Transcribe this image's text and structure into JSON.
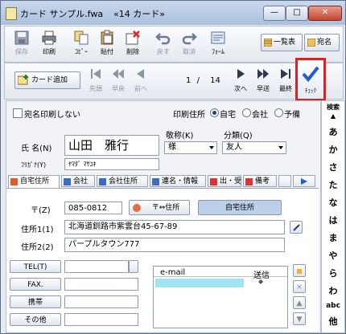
{
  "window": {
    "title": "カード サンプル.fwa",
    "card_label": "«14 カード»",
    "minimize": "—",
    "maximize": "□",
    "close": "✕"
  },
  "toolbar": {
    "tools": [
      {
        "label": "保存",
        "icon": "save-icon",
        "enabled": false
      },
      {
        "label": "印刷",
        "icon": "printer-icon",
        "enabled": true
      },
      {
        "label": "ｺﾋﾟｰ",
        "icon": "copy-icon",
        "enabled": true
      },
      {
        "label": "貼付",
        "icon": "paste-icon",
        "enabled": true
      },
      {
        "label": "削除",
        "icon": "delete-icon",
        "enabled": true
      },
      {
        "label": "戻す",
        "icon": "undo-icon",
        "enabled": false
      },
      {
        "label": "取消",
        "icon": "redo-icon",
        "enabled": false
      },
      {
        "label": "ﾌｫｰﾑ",
        "icon": "form-icon",
        "enabled": true
      }
    ],
    "list_button": "一覧表",
    "name_button": "宛名"
  },
  "navbar": {
    "add_card": "カード追加",
    "first": "先頭",
    "fast_back": "早戻",
    "prev": "前へ",
    "current": "1",
    "separator": "/",
    "total": "14",
    "next": "次へ",
    "fast_forward": "早送",
    "last": "最終",
    "check": "ﾁｪｯｸ"
  },
  "form": {
    "no_print_label": "宛名印刷しない",
    "print_addr_label": "印刷住所",
    "radio_home": "自宅",
    "radio_company": "会社",
    "radio_spare": "予備",
    "name_label": "氏 名(N)",
    "name_value": "山田　雅行",
    "honorific_label": "敬称(K)",
    "honorific_value": "様",
    "category_label": "分類(Q)",
    "category_value": "友人",
    "furigana_label": "ﾌﾘｶﾞﾅ(Y)",
    "furigana_value": "ﾔﾏﾀﾞ ﾏｻﾕｷ"
  },
  "tabs": [
    "自宅住所",
    "会社",
    "会社住所",
    "連名・情報",
    "出・受",
    "備考"
  ],
  "address": {
    "zip_label": "〒(Z)",
    "zip_value": "085-0812",
    "zip_convert_button": "〒⇔住所",
    "home_address_button": "自宅住所",
    "addr1_label": "住所1(1)",
    "addr1_value": "北海道釧路市紫雲台45-67-89",
    "addr2_label": "住所2(2)",
    "addr2_value": "パープルタウン777"
  },
  "contact": {
    "tel_button": "TEL(T)",
    "fax_button": "FAX.",
    "mobile_button": "携帯",
    "other_button": "その他"
  },
  "email": {
    "col_email": "e-mail",
    "col_send": "送信",
    "row_marker": "◆"
  },
  "kana_index": {
    "label": "検索",
    "items": [
      "あ",
      "か",
      "さ",
      "た",
      "な",
      "は",
      "ま",
      "や",
      "ら",
      "わ",
      "abc",
      "他"
    ]
  }
}
